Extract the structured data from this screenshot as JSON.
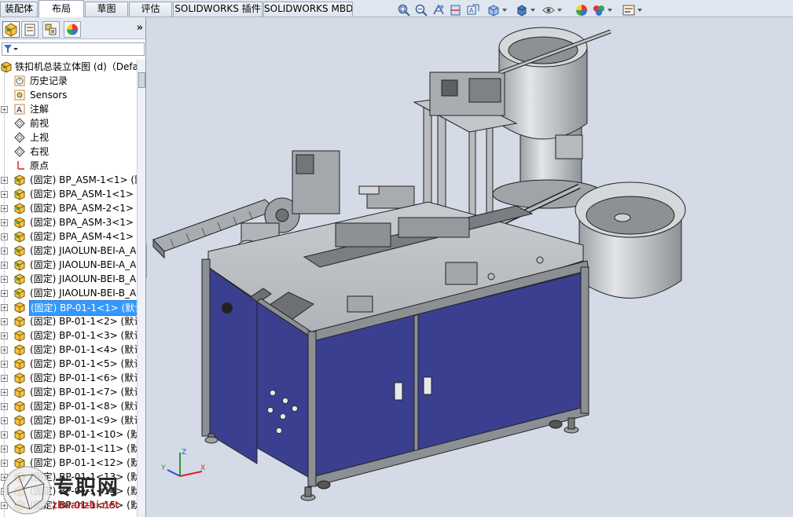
{
  "tabs": [
    "装配体",
    "布局",
    "草图",
    "评估",
    "SOLIDWORKS 插件",
    "SOLIDWORKS MBD"
  ],
  "active_tab_index": 1,
  "hud_icons": [
    "zoom-to-fit-icon",
    "zoom-area-icon",
    "previous-view-icon",
    "section-view-icon",
    "dynamic-annotation-icon",
    "view-orientation-icon",
    "display-style-icon",
    "hide-show-icon",
    "edit-appearance-icon",
    "apply-scene-icon",
    "view-settings-icon"
  ],
  "fm_tabs": [
    "featuremanager-tab-icon",
    "propertymanager-tab-icon",
    "configurationmanager-tab-icon",
    "displaymanager-tab-icon"
  ],
  "fm_more": "»",
  "tree": {
    "root": "铁扣机总装立体图 (d)（Defa",
    "items": [
      {
        "label": "历史记录",
        "icon": "history-icon",
        "kind": "child"
      },
      {
        "label": "Sensors",
        "icon": "sensors-icon",
        "kind": "child"
      },
      {
        "label": "注解",
        "icon": "annotations-icon",
        "kind": "expand"
      },
      {
        "label": "前视",
        "icon": "plane-icon",
        "kind": "child"
      },
      {
        "label": "上视",
        "icon": "plane-icon",
        "kind": "child"
      },
      {
        "label": "右视",
        "icon": "plane-icon",
        "kind": "child"
      },
      {
        "label": "原点",
        "icon": "origin-icon",
        "kind": "child"
      },
      {
        "label": "(固定) BP_ASM-1<1> (默",
        "icon": "subassembly-icon",
        "kind": "expand"
      },
      {
        "label": "(固定) BPA_ASM-1<1> (",
        "icon": "subassembly-icon",
        "kind": "expand"
      },
      {
        "label": "(固定) BPA_ASM-2<1> (",
        "icon": "subassembly-icon",
        "kind": "expand"
      },
      {
        "label": "(固定) BPA_ASM-3<1> (",
        "icon": "subassembly-icon",
        "kind": "expand"
      },
      {
        "label": "(固定) BPA_ASM-4<1> (",
        "icon": "subassembly-icon",
        "kind": "expand"
      },
      {
        "label": "(固定) JIAOLUN-BEI-A_A",
        "icon": "subassembly-icon",
        "kind": "expand"
      },
      {
        "label": "(固定) JIAOLUN-BEI-A_A",
        "icon": "subassembly-icon",
        "kind": "expand"
      },
      {
        "label": "(固定) JIAOLUN-BEI-B_A",
        "icon": "subassembly-icon",
        "kind": "expand"
      },
      {
        "label": "(固定) JIAOLUN-BEI-B_A",
        "icon": "subassembly-icon",
        "kind": "expand"
      },
      {
        "label": "(固定) BP-01-1<1> (默认",
        "icon": "part-icon",
        "kind": "expand",
        "selected": true
      },
      {
        "label": "(固定) BP-01-1<2> (默认",
        "icon": "part-icon",
        "kind": "expand"
      },
      {
        "label": "(固定) BP-01-1<3> (默认",
        "icon": "part-icon",
        "kind": "expand"
      },
      {
        "label": "(固定) BP-01-1<4> (默认",
        "icon": "part-icon",
        "kind": "expand"
      },
      {
        "label": "(固定) BP-01-1<5> (默认",
        "icon": "part-icon",
        "kind": "expand"
      },
      {
        "label": "(固定) BP-01-1<6> (默认",
        "icon": "part-icon",
        "kind": "expand"
      },
      {
        "label": "(固定) BP-01-1<7> (默认",
        "icon": "part-icon",
        "kind": "expand"
      },
      {
        "label": "(固定) BP-01-1<8> (默认",
        "icon": "part-icon",
        "kind": "expand"
      },
      {
        "label": "(固定) BP-01-1<9> (默认",
        "icon": "part-icon",
        "kind": "expand"
      },
      {
        "label": "(固定) BP-01-1<10> (默",
        "icon": "part-icon",
        "kind": "expand"
      },
      {
        "label": "(固定) BP-01-1<11> (默",
        "icon": "part-icon",
        "kind": "expand"
      },
      {
        "label": "(固定) BP-01-1<12> (默",
        "icon": "part-icon",
        "kind": "expand"
      },
      {
        "label": "(固定) BP-01-1<13> (默",
        "icon": "part-icon",
        "kind": "expand"
      },
      {
        "label": "(固定) BP-01-1<14> (默",
        "icon": "part-icon",
        "kind": "expand"
      },
      {
        "label": "(固定) BP-01-1<15> (默",
        "icon": "part-icon",
        "kind": "expand"
      }
    ]
  },
  "triad": {
    "x": "X",
    "y": "Y",
    "z": "Z"
  },
  "watermark": {
    "text": "专职网",
    "sub": "zhuanzhi.net"
  },
  "colors": {
    "cabinet": "#3b3f8f",
    "frame": "#8c8f94",
    "metal": "#b9bcc0",
    "selection": "#3399ff",
    "background": "#d4dbe6"
  }
}
